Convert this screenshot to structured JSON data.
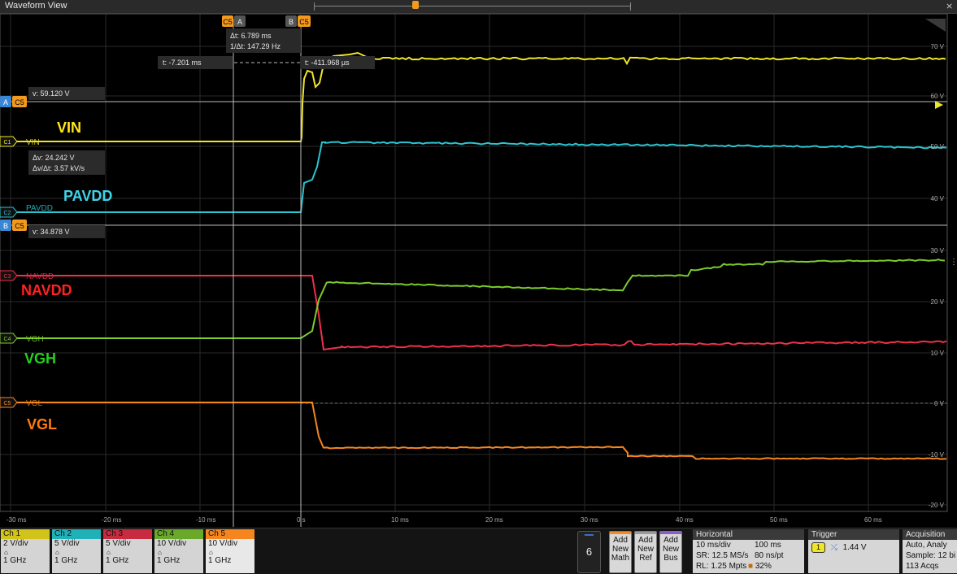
{
  "window": {
    "title": "Waveform View",
    "close": "⨯"
  },
  "colors": {
    "c1": "#f0e628",
    "c2": "#2bc4d0",
    "c3": "#f0304a",
    "c4": "#7ccc2c",
    "c5": "#f5861e",
    "cursorA": "#3a86d6",
    "cursorB": "#3a86d6",
    "cursorChip": "#f39a1e",
    "grid": "#2a2a2a",
    "label_c1": "#ffe81a",
    "label_c2": "#3fd3e8",
    "label_c3": "#ff2222",
    "label_c4": "#22d11e",
    "label_c5": "#ff7a10"
  },
  "cursors": {
    "a_chip": "C5",
    "a_label": "A",
    "b_label": "B",
    "b_chip": "C5",
    "dt": "Δt: 6.789 ms",
    "inv_dt": "1/Δt: 147.29 Hz",
    "t_a": "t: -7.201 ms",
    "t_b": "t: -411.968 µs",
    "hA_label": "A",
    "hA_chip": "C5",
    "hA_value": "v: 59.120 V",
    "hB_label": "B",
    "hB_chip": "C5",
    "hB_value": "v: 34.878 V",
    "dv": "Δv: 24.242 V",
    "dvdt": "Δv/Δt: 3.57 kV/s"
  },
  "channels": [
    {
      "id": "C1",
      "trace_label": "VIN",
      "big_label": "VIN"
    },
    {
      "id": "C2",
      "trace_label": "PAVDD",
      "big_label": "PAVDD"
    },
    {
      "id": "C3",
      "trace_label": "NAVDD",
      "big_label": "NAVDD"
    },
    {
      "id": "C4",
      "trace_label": "VGH",
      "big_label": "VGH"
    },
    {
      "id": "C5",
      "trace_label": "VGL",
      "big_label": "VGL"
    }
  ],
  "x_ticks": [
    "-30 ms",
    "-20 ms",
    "-10 ms",
    "0 s",
    "10 ms",
    "20 ms",
    "30 ms",
    "40 ms",
    "50 ms",
    "60 ms"
  ],
  "y_ticks": [
    "70 V",
    "60 V",
    "50 V",
    "40 V",
    "30 V",
    "20 V",
    "10 V",
    "0 V",
    "-10 V",
    "-20 V"
  ],
  "bottom": {
    "ch_boxes": [
      {
        "name": "Ch 1",
        "scale": "2 V/div",
        "bw": "1 GHz",
        "color": "#d2c31a"
      },
      {
        "name": "Ch 2",
        "scale": "5 V/div",
        "bw": "1 GHz",
        "color": "#1fb0b8"
      },
      {
        "name": "Ch 3",
        "scale": "5 V/div",
        "bw": "1 GHz",
        "color": "#c82a40"
      },
      {
        "name": "Ch 4",
        "scale": "10 V/div",
        "bw": "1 GHz",
        "color": "#6aa82a"
      },
      {
        "name": "Ch 5",
        "scale": "10 V/div",
        "bw": "1 GHz",
        "color": "#f0902a"
      }
    ],
    "six": "6",
    "add_math": [
      "Add",
      "New",
      "Math"
    ],
    "add_ref": [
      "Add",
      "New",
      "Ref"
    ],
    "add_bus": [
      "Add",
      "New",
      "Bus"
    ],
    "horizontal": {
      "title": "Horizontal",
      "r1a": "10 ms/div",
      "r1b": "100 ms",
      "r2a": "SR: 12.5 MS/s",
      "r2b": "80 ns/pt",
      "r3a": "RL: 1.25 Mpts",
      "r3b": "32%"
    },
    "trigger": {
      "title": "Trigger",
      "src": "1",
      "level": "1.44 V"
    },
    "acquisition": {
      "title": "Acquisition",
      "r1": "Auto,   Analy",
      "r2": "Sample: 12 bi",
      "r3": "113 Acqs"
    }
  }
}
